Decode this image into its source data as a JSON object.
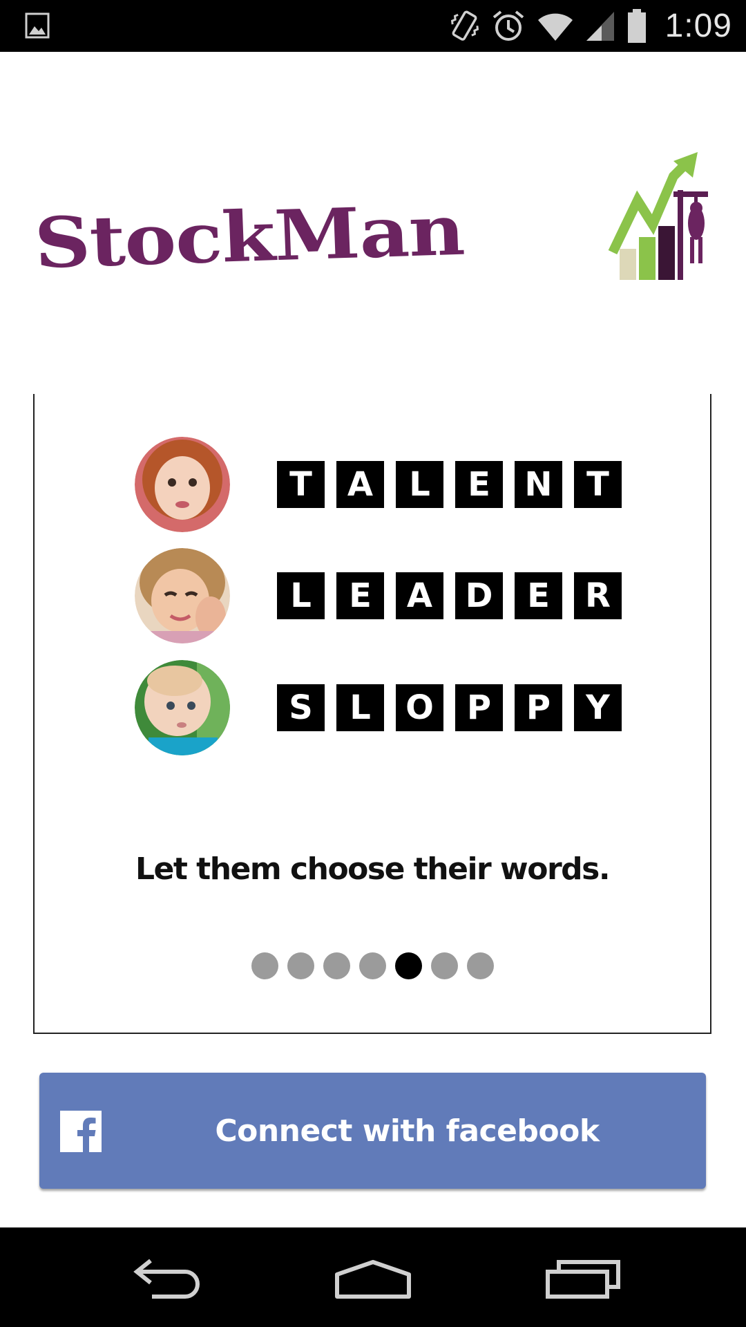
{
  "status_bar": {
    "time": "1:09",
    "icons": [
      "gallery-icon",
      "vibrate-icon",
      "alarm-icon",
      "wifi-icon",
      "signal-icon",
      "battery-icon"
    ]
  },
  "logo": {
    "text": "StockMan",
    "color": "#6b2460",
    "accent_green": "#8bc34a"
  },
  "card": {
    "rows": [
      {
        "avatar": "child-1-avatar",
        "letters": [
          "T",
          "A",
          "L",
          "E",
          "N",
          "T"
        ]
      },
      {
        "avatar": "child-2-avatar",
        "letters": [
          "L",
          "E",
          "A",
          "D",
          "E",
          "R"
        ]
      },
      {
        "avatar": "child-3-avatar",
        "letters": [
          "S",
          "L",
          "O",
          "P",
          "P",
          "Y"
        ]
      }
    ],
    "tagline": "Let them choose their words.",
    "pager": {
      "count": 7,
      "active_index": 4
    }
  },
  "facebook_button": {
    "label": "Connect with facebook",
    "color": "#617bb9"
  },
  "nav_bar": {
    "buttons": [
      "back-icon",
      "home-icon",
      "recent-apps-icon"
    ]
  }
}
